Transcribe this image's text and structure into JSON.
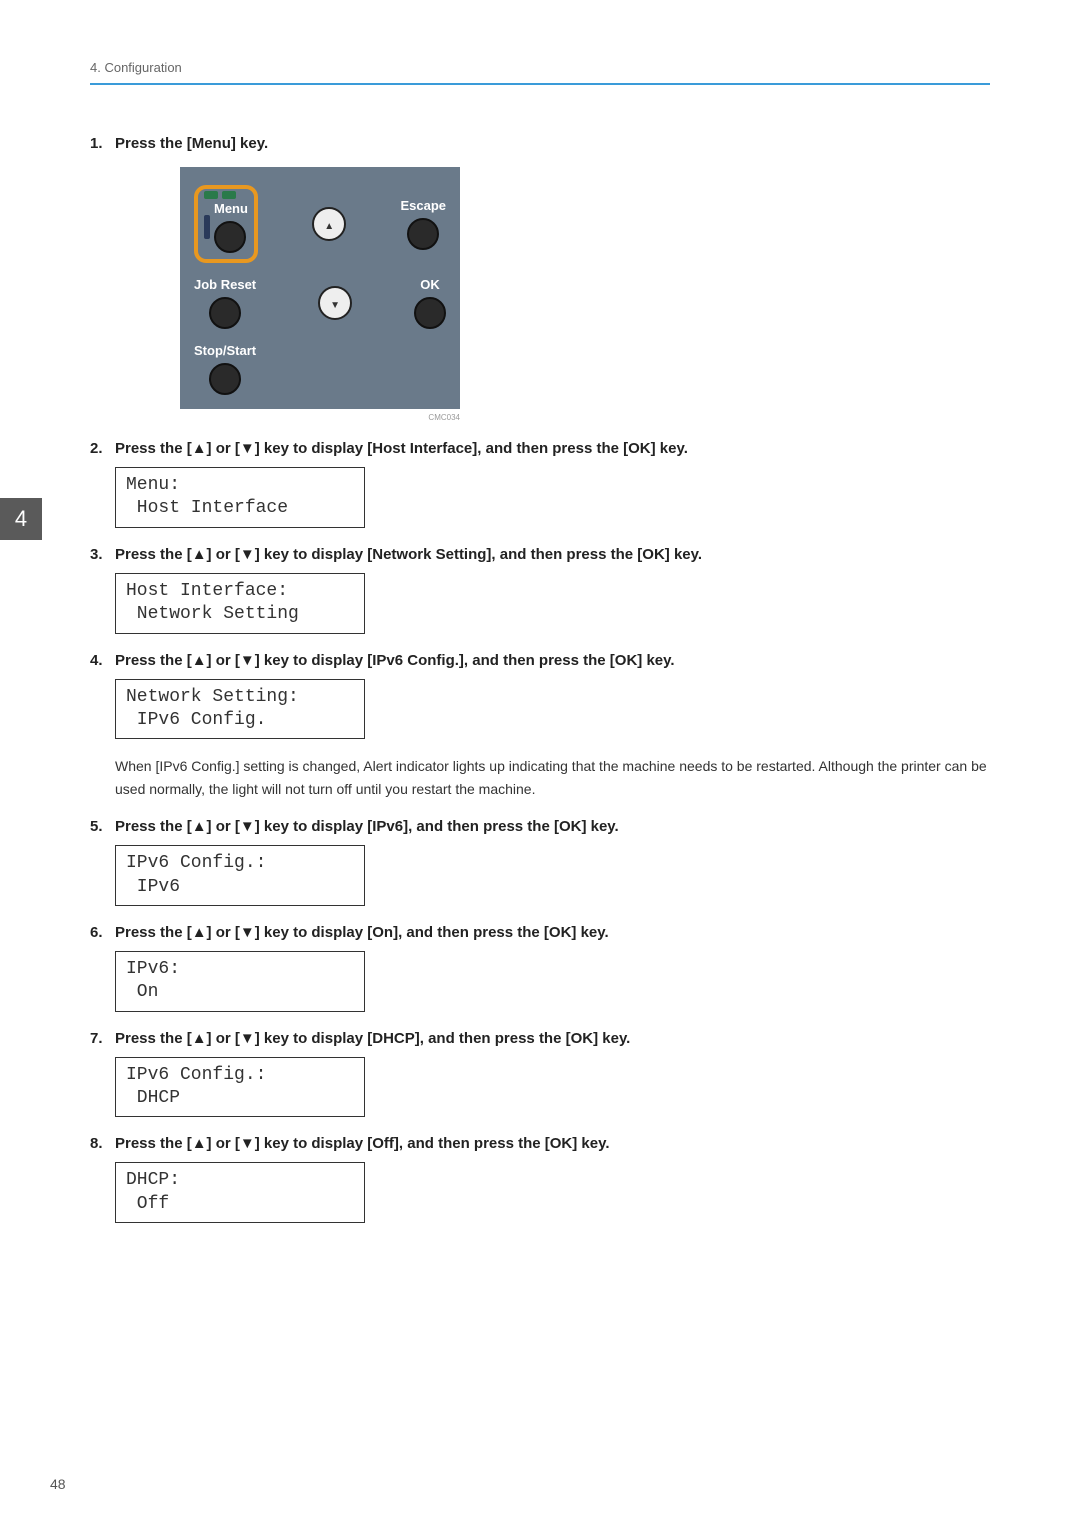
{
  "header": {
    "chapter": "4. Configuration"
  },
  "section_tab": "4",
  "panel": {
    "menu": "Menu",
    "escape": "Escape",
    "job_reset": "Job Reset",
    "ok": "OK",
    "stop_start": "Stop/Start",
    "cmc": "CMC034"
  },
  "steps": [
    {
      "num": "1.",
      "text": "Press the [Menu] key."
    },
    {
      "num": "2.",
      "text": "Press the [▲] or [▼] key to display [Host Interface], and then press the [OK] key.",
      "lcd": "Menu:\n Host Interface"
    },
    {
      "num": "3.",
      "text": "Press the [▲] or [▼] key to display [Network Setting], and then press the [OK] key.",
      "lcd": "Host Interface:\n Network Setting"
    },
    {
      "num": "4.",
      "text": "Press the [▲] or [▼] key to display [IPv6 Config.], and then press the [OK] key.",
      "lcd": "Network Setting:\n IPv6 Config.",
      "body": "When [IPv6 Config.] setting is changed, Alert indicator lights up indicating that the machine needs to be restarted. Although the printer can be used normally, the light will not turn off until you restart the machine."
    },
    {
      "num": "5.",
      "text": "Press the [▲] or [▼] key to display [IPv6], and then press the [OK] key.",
      "lcd": "IPv6 Config.:\n IPv6"
    },
    {
      "num": "6.",
      "text": "Press the [▲] or [▼] key to display [On], and then press the [OK] key.",
      "lcd": "IPv6:\n On"
    },
    {
      "num": "7.",
      "text": "Press the [▲] or [▼] key to display [DHCP], and then press the [OK] key.",
      "lcd": "IPv6 Config.:\n DHCP"
    },
    {
      "num": "8.",
      "text": "Press the [▲] or [▼] key to display [Off], and then press the [OK] key.",
      "lcd": "DHCP:\n Off"
    }
  ],
  "page_number": "48"
}
